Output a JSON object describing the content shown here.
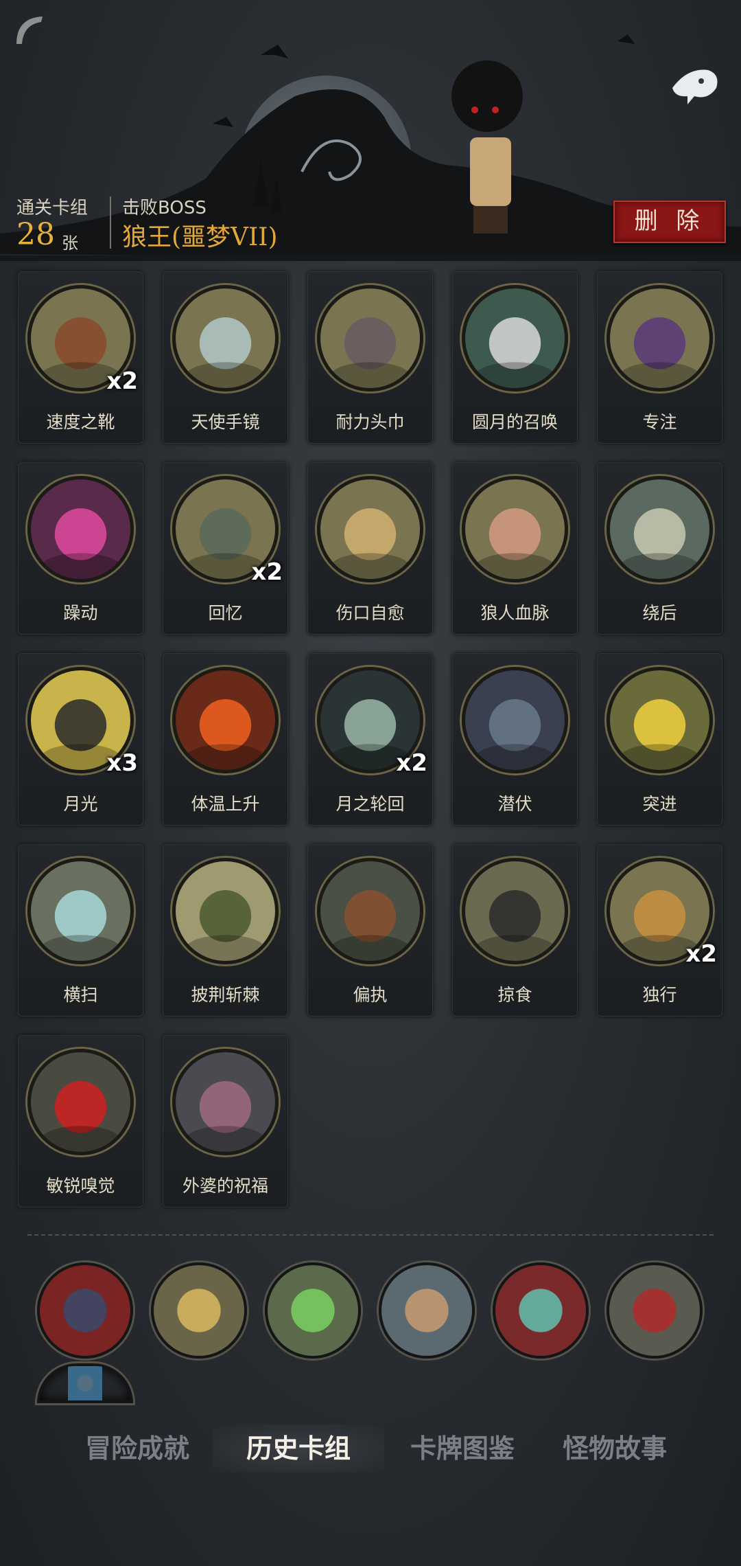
{
  "header": {
    "clear_label": "通关卡组",
    "clear_count": "28",
    "clear_unit": "张",
    "boss_label": "击败BOSS",
    "boss_name": "狼王(噩梦VII)",
    "delete_label": "删 除"
  },
  "cards": [
    {
      "name": "速度之靴",
      "count": "x2",
      "icon": "boot-icon"
    },
    {
      "name": "天使手镜",
      "count": "",
      "icon": "hand-mirror-icon"
    },
    {
      "name": "耐力头巾",
      "count": "",
      "icon": "bandana-icon"
    },
    {
      "name": "圆月的召唤",
      "count": "",
      "icon": "full-moon-forest-icon"
    },
    {
      "name": "专注",
      "count": "",
      "icon": "wizard-icon"
    },
    {
      "name": "躁动",
      "count": "",
      "icon": "restless-flame-icon"
    },
    {
      "name": "回忆",
      "count": "x2",
      "icon": "old-man-icon"
    },
    {
      "name": "伤口自愈",
      "count": "",
      "icon": "healing-boy-icon"
    },
    {
      "name": "狼人血脉",
      "count": "",
      "icon": "werewolf-hand-icon"
    },
    {
      "name": "绕后",
      "count": "",
      "icon": "skeleton-pirate-icon"
    },
    {
      "name": "月光",
      "count": "x3",
      "icon": "yellow-moon-icon"
    },
    {
      "name": "体温上升",
      "count": "",
      "icon": "burning-wolf-icon"
    },
    {
      "name": "月之轮回",
      "count": "x2",
      "icon": "moon-phases-icon"
    },
    {
      "name": "潜伏",
      "count": "",
      "icon": "lurking-wolf-icon"
    },
    {
      "name": "突进",
      "count": "",
      "icon": "charging-wolf-icon"
    },
    {
      "name": "横扫",
      "count": "",
      "icon": "sweeping-wolf-icon"
    },
    {
      "name": "披荆斩棘",
      "count": "",
      "icon": "thorn-axe-icon"
    },
    {
      "name": "偏执",
      "count": "",
      "icon": "wolf-and-bear-icon"
    },
    {
      "name": "掠食",
      "count": "",
      "icon": "predator-wolf-icon"
    },
    {
      "name": "独行",
      "count": "x2",
      "icon": "lone-boy-icon"
    },
    {
      "name": "敏锐嗅觉",
      "count": "",
      "icon": "red-eye-wolf-icon"
    },
    {
      "name": "外婆的祝福",
      "count": "",
      "icon": "grandma-icon"
    }
  ],
  "relics": [
    {
      "icon": "werewolf-relic-icon"
    },
    {
      "icon": "hourglass-relic-icon"
    },
    {
      "icon": "poison-arm-relic-icon"
    },
    {
      "icon": "pirate-crew-relic-icon"
    },
    {
      "icon": "red-hourglass-relic-icon"
    },
    {
      "icon": "skull-card-relic-icon"
    },
    {
      "icon": "blue-card-relic-icon"
    }
  ],
  "tabs": [
    {
      "label": "冒险成就",
      "active": false
    },
    {
      "label": "历史卡组",
      "active": true
    },
    {
      "label": "卡牌图鉴",
      "active": false
    },
    {
      "label": "怪物故事",
      "active": false
    }
  ],
  "colors": {
    "accent_gold": "#e4a83a",
    "delete_red": "#8a1616",
    "card_ring": "#6b6447"
  }
}
